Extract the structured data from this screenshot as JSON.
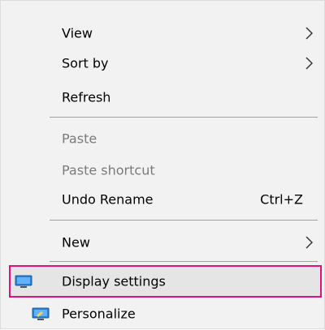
{
  "menu": {
    "items": [
      {
        "label": "View"
      },
      {
        "label": "Sort by"
      },
      {
        "label": "Refresh"
      },
      {
        "label": "Paste"
      },
      {
        "label": "Paste shortcut"
      },
      {
        "label": "Undo Rename",
        "shortcut": "Ctrl+Z"
      },
      {
        "label": "New"
      },
      {
        "label": "Display settings",
        "icon": "monitor-icon"
      },
      {
        "label": "Personalize",
        "icon": "personalize-icon"
      }
    ],
    "highlight_color": "#e2127a",
    "disabled_color": "#7a7a7a"
  }
}
